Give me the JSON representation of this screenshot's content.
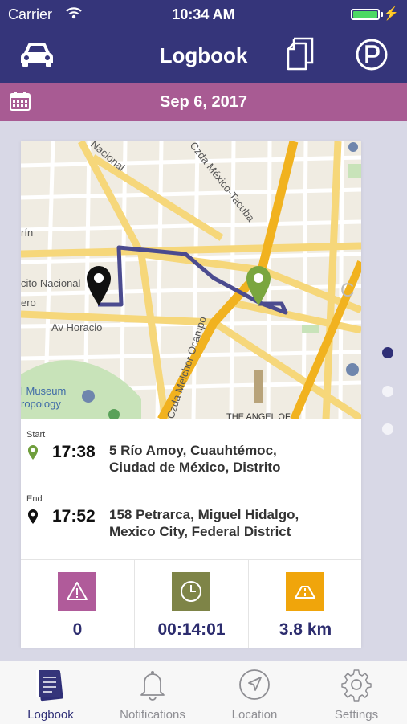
{
  "status_bar": {
    "carrier": "Carrier",
    "time": "10:34 AM"
  },
  "nav_bar": {
    "title": "Logbook",
    "left_icon": "car-icon",
    "right_icons": [
      "copy-icon",
      "parking-icon"
    ]
  },
  "date_bar": {
    "date": "Sep 6, 2017",
    "icon": "calendar-icon"
  },
  "map": {
    "labels": [
      "Nacional",
      "Czda México-Tacuba",
      "Czda Melchor Ocampo",
      "cito Nacional",
      "Av Horacio",
      "THE ANGEL OF",
      "l Museum",
      "ropology",
      "ero",
      "rín",
      "C"
    ]
  },
  "trip": {
    "start": {
      "label": "Start",
      "time": "17:38",
      "address_line1": "5 Río Amoy, Cuauhtémoc,",
      "address_line2": "Ciudad de México, Distrito"
    },
    "end": {
      "label": "End",
      "time": "17:52",
      "address_line1": "158 Petrarca, Miguel Hidalgo,",
      "address_line2": "Mexico City, Federal District"
    }
  },
  "stats": [
    {
      "icon": "warning-icon",
      "value": "0",
      "color": "#b05b9a"
    },
    {
      "icon": "clock-icon",
      "value": "00:14:01",
      "color": "#7e8447"
    },
    {
      "icon": "road-icon",
      "value": "3.8 km",
      "color": "#f0a50b"
    }
  ],
  "colors": {
    "nav": "#35357a",
    "date_bar": "#a85b93",
    "route": "#4b4b8f",
    "start_pin": "#6f9e3c",
    "end_pin": "#111111"
  },
  "tabs": [
    {
      "label": "Logbook",
      "active": true
    },
    {
      "label": "Notifications",
      "active": false
    },
    {
      "label": "Location",
      "active": false
    },
    {
      "label": "Settings",
      "active": false
    }
  ]
}
